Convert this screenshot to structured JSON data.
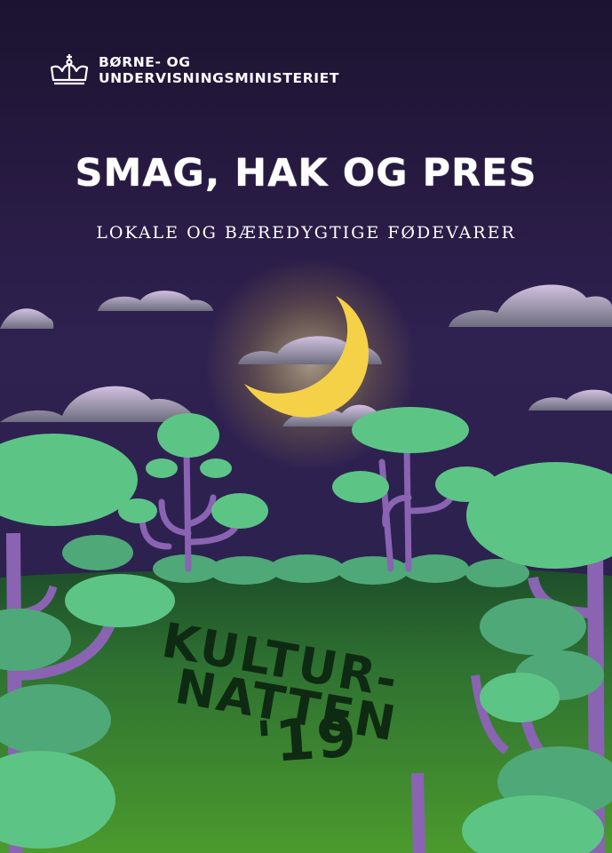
{
  "ministry": {
    "line1": "BØRNE- OG",
    "line2": "UNDERVISNINGSMINISTERIET",
    "logo_icon": "crown-icon"
  },
  "title": "SMAG, HAK OG PRES",
  "subtitle": "LOKALE OG BÆREDYGTIGE FØDEVARER",
  "event": {
    "line1": "KULTUR-",
    "line2": "NATTEN",
    "line3": "'19"
  },
  "colors": {
    "sky_top": "#1b1330",
    "sky_mid": "#2f2150",
    "moon": "#f5d147",
    "cloud": "#8a8799",
    "cloud_light": "#c9b8d9",
    "tree_canopy": "#5cc586",
    "tree_trunk": "#8a63b2",
    "bush": "#4fa878",
    "meadow": "#3f8e2d",
    "lettering": "#0f2a12"
  }
}
